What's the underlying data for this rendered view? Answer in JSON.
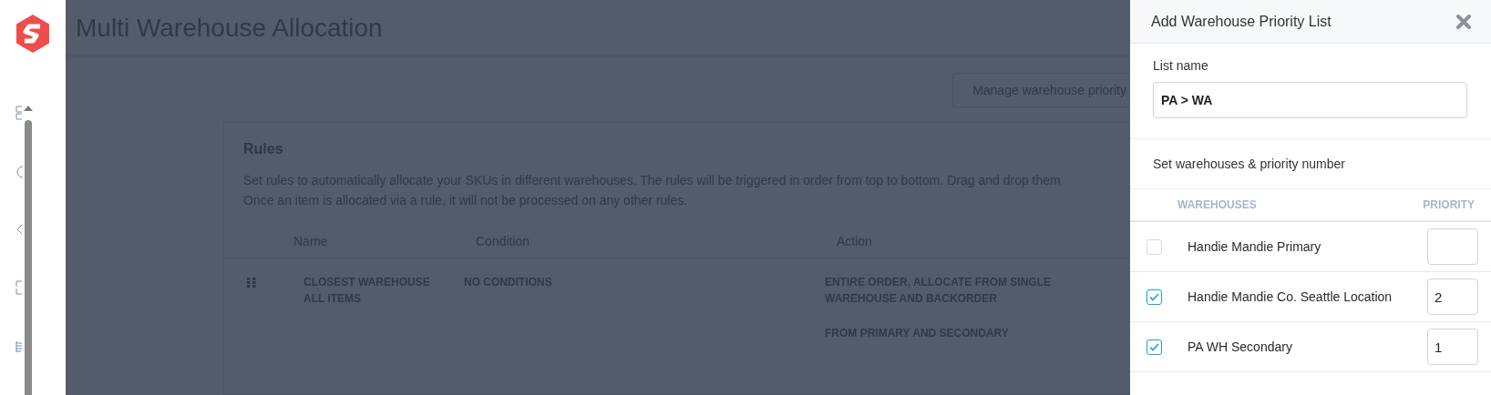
{
  "page": {
    "title": "Multi Warehouse Allocation",
    "manage_button": "Manage warehouse priority"
  },
  "rules": {
    "title": "Rules",
    "description": "Set rules to automatically allocate your SKUs in different warehouses. The rules will be triggered in order from top to bottom. Drag and drop them\nOnce an item is allocated via a rule, it will not be processed on any other rules.",
    "columns": [
      "Name",
      "Condition",
      "Action"
    ],
    "rows": [
      {
        "name": "CLOSEST WAREHOUSE\nALL ITEMS",
        "condition": "NO CONDITIONS",
        "actions": [
          "ENTIRE ORDER, ALLOCATE FROM SINGLE\nWAREHOUSE AND BACKORDER",
          "FROM PRIMARY AND SECONDARY"
        ]
      }
    ]
  },
  "drawer": {
    "title": "Add Warehouse Priority List",
    "list_name_label": "List name",
    "list_name_value": "PA > WA",
    "section_label": "Set warehouses & priority number",
    "columns": [
      "WAREHOUSES",
      "PRIORITY"
    ],
    "warehouses": [
      {
        "name": "Handie Mandie Primary",
        "checked": false
      },
      {
        "name": "Handie Mandie Co. Seattle Location",
        "checked": true,
        "priority": "2"
      },
      {
        "name": "PA WH Secondary",
        "checked": true,
        "priority": "1"
      }
    ]
  }
}
